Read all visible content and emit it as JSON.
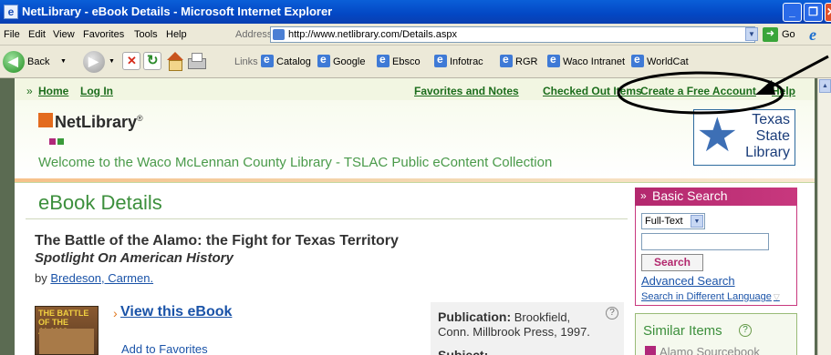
{
  "window": {
    "title": "NetLibrary - eBook Details - Microsoft Internet Explorer",
    "controls": [
      "_",
      "❐",
      "✕"
    ]
  },
  "menubar": {
    "items": [
      "File",
      "Edit",
      "View",
      "Favorites",
      "Tools",
      "Help"
    ],
    "address_label": "Address",
    "url": "http://www.netlibrary.com/Details.aspx",
    "go_label": "Go"
  },
  "toolbar": {
    "back_label": "Back",
    "links_label": "Links",
    "links": [
      "Catalog",
      "Google",
      "Ebsco",
      "Infotrac",
      "RGR",
      "Waco Intranet",
      "WorldCat"
    ]
  },
  "topnav": {
    "home": "Home",
    "login": "Log In",
    "favorites": "Favorites and Notes",
    "checked_out": "Checked Out Items",
    "create_account": "Create a Free Account",
    "help": "Help"
  },
  "header": {
    "logo": "NetLibrary",
    "logo_tm": "®",
    "welcome": "Welcome to the Waco McLennan County Library - TSLAC Public eContent Collection",
    "partner_logo": [
      "Texas",
      "State",
      "Library"
    ]
  },
  "main": {
    "section_title": "eBook Details",
    "book_title": "The Battle of the Alamo: the Fight for Texas Territory",
    "series": "Spotlight On American History",
    "by_prefix": "by",
    "author": "Bredeson, Carmen.",
    "cover_text": "THE BATTLE OF THE ALAMO",
    "view_link": "View this eBook",
    "add_favorites": "Add to Favorites",
    "publication_label": "Publication:",
    "publication_value": "Brookfield, Conn. Millbrook Press, 1997.",
    "subject_label": "Subject:"
  },
  "sidebar": {
    "basic_search_title": "Basic Search",
    "search_type": "Full-Text",
    "search_value": "",
    "search_button": "Search",
    "advanced_search": "Advanced Search",
    "different_language": "Search in Different Language",
    "similar_items_title": "Similar Items",
    "similar_first": "Alamo Sourcebook"
  },
  "colors": {
    "accent_green": "#3c8f3c",
    "accent_magenta": "#b3286e",
    "link_blue": "#1a53a8"
  }
}
